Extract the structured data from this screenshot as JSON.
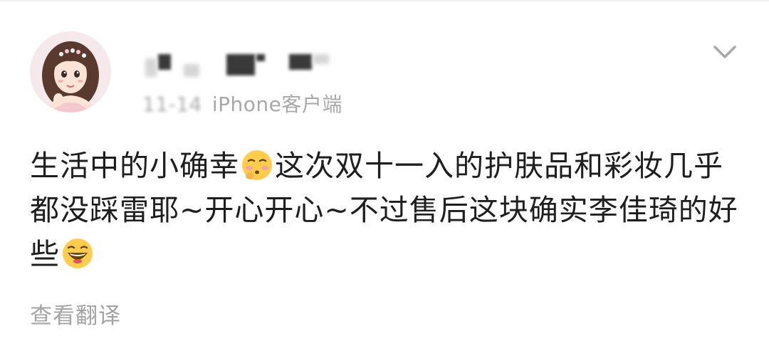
{
  "post": {
    "author": {
      "avatar": "avatar-illustration",
      "name_obscured": true
    },
    "meta": {
      "time": "11-14",
      "source": "iPhone客户端"
    },
    "text_parts": {
      "part1": "生活中的小确幸",
      "part2": "这次双十一入的护肤品和彩妆几乎都没踩雷耶~开心开心~不过售后这块确实李佳琦的好些"
    },
    "emojis": [
      "flushed-face-emoji",
      "laughing-face-emoji"
    ],
    "translate_label": "查看翻译",
    "menu_icon": "chevron-down-icon"
  }
}
